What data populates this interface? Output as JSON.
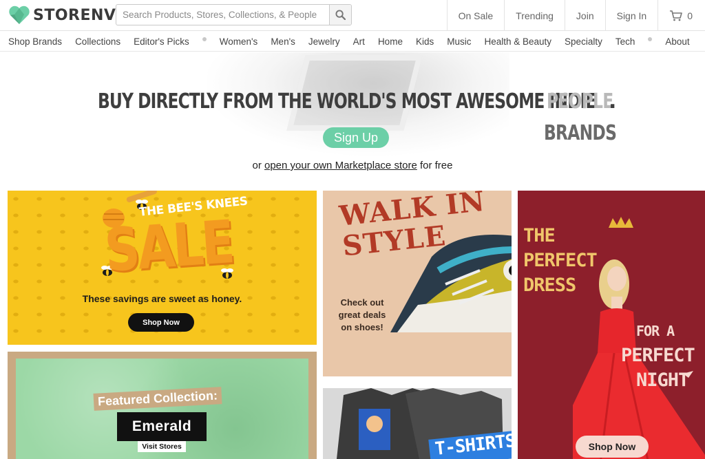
{
  "brand": {
    "name": "STORENVY",
    "accent": "#6ccfa7"
  },
  "search": {
    "placeholder": "Search Products, Stores, Collections, & People",
    "icon": "search-icon"
  },
  "topnav": {
    "on_sale": "On Sale",
    "trending": "Trending",
    "join": "Join",
    "sign_in": "Sign In",
    "cart_count": "0"
  },
  "categories": [
    "Shop Brands",
    "Collections",
    "Editor's Picks",
    "Women's",
    "Men's",
    "Jewelry",
    "Art",
    "Home",
    "Kids",
    "Music",
    "Health & Beauty",
    "Specialty",
    "Tech",
    "About"
  ],
  "hero": {
    "headline": "BUY DIRECTLY FROM THE WORLD'S MOST AWESOME INDIE",
    "word_primary": "PEOPLE",
    "period": ".",
    "word_secondary": "BRANDS",
    "signup": "Sign Up",
    "sub_prefix": "or",
    "sub_link": "open your own Marketplace store",
    "sub_suffix": "for free"
  },
  "promos": {
    "bees": {
      "kicker": "THE BEE'S KNEES",
      "title": "SALE",
      "tagline": "These savings are sweet as honey.",
      "cta": "Shop Now",
      "bg": "#f7c51d"
    },
    "shoes": {
      "title_line1": "WALK IN",
      "title_line2": "STYLE",
      "subtitle_line1": "Check out",
      "subtitle_line2": "great deals",
      "subtitle_line3": "on shoes!",
      "bg": "#e9c7a9"
    },
    "dress": {
      "title_line1": "THE",
      "title_line2": "PERFECT",
      "title_line3": "DRESS",
      "sub_line1": "FOR A",
      "sub_line2": "PERFECT",
      "sub_line3": "NIGHT",
      "cta": "Shop Now",
      "bg": "#8d1f2b"
    },
    "emerald": {
      "kicker": "Featured Collection:",
      "title": "Emerald",
      "cta": "Visit Stores",
      "bg": "#9cd8a6"
    },
    "shirts": {
      "label": "T-SHIRTS"
    }
  }
}
